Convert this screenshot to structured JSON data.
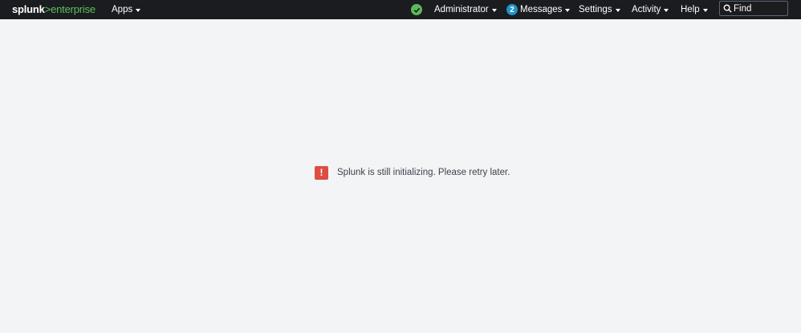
{
  "header": {
    "logo": {
      "brand": "splunk",
      "separator": ">",
      "edition": "enterprise"
    },
    "apps_label": "Apps",
    "status_icon": "check-circle-icon",
    "user_label": "Administrator",
    "messages": {
      "count": "2",
      "label": "Messages"
    },
    "settings_label": "Settings",
    "activity_label": "Activity",
    "help_label": "Help",
    "search": {
      "placeholder": "Find",
      "value": ""
    }
  },
  "main": {
    "message_icon": "exclamation-icon",
    "message_text": "Splunk is still initializing. Please retry later."
  },
  "colors": {
    "topbar_bg": "#1a1c20",
    "page_bg": "#f2f4f5",
    "brand_green": "#5cc05c",
    "status_green": "#5cb85c",
    "badge_blue": "#1e93c6",
    "error_red": "#dc4e41"
  }
}
